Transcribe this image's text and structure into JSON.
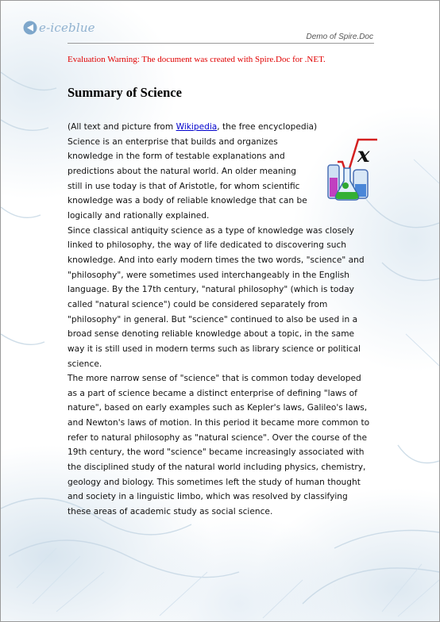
{
  "header": {
    "logo_text": "e-iceblue",
    "right_text": "Demo of Spire.Doc"
  },
  "warning": "Evaluation Warning: The document was created with Spire.Doc for .NET.",
  "title": "Summary of Science",
  "intro": {
    "prefix": "(All text and picture from ",
    "link_text": "Wikipedia",
    "suffix": ", the free encyclopedia)"
  },
  "paragraphs": [
    "Science is an enterprise that builds and organizes knowledge in the form of testable explanations and predictions about the natural world. An older meaning still in use today is that of Aristotle, for whom scientific knowledge was a body of reliable knowledge that can be logically and rationally explained.",
    "Since classical antiquity science as a type of knowledge was closely linked to philosophy, the way of life dedicated to discovering such knowledge. And into early modern times the two words, \"science\" and \"philosophy\", were sometimes used interchangeably in the English language. By the 17th century, \"natural philosophy\" (which is today called \"natural science\") could be considered separately from \"philosophy\" in general. But \"science\" continued to also be used in a broad sense denoting reliable knowledge about a topic, in the same way it is still used in modern terms such as library science or political science.",
    "The more narrow sense of \"science\" that is common today developed as a part of science became a distinct enterprise of defining \"laws of nature\", based on early examples such as Kepler's laws, Galileo's laws, and Newton's laws of motion. In this period it became more common to refer to natural philosophy as \"natural science\". Over the course of the 19th century, the word \"science\" became increasingly associated with the disciplined study of the natural world including physics, chemistry, geology and biology. This sometimes left the study of human thought and society in a linguistic limbo, which was resolved by classifying these areas of academic study as social science."
  ],
  "figure": {
    "icon": "science-flask-formula-icon",
    "symbol": "x"
  },
  "colors": {
    "warning": "#e00000",
    "link": "#0000cc",
    "logo": "#8fb1cf"
  }
}
